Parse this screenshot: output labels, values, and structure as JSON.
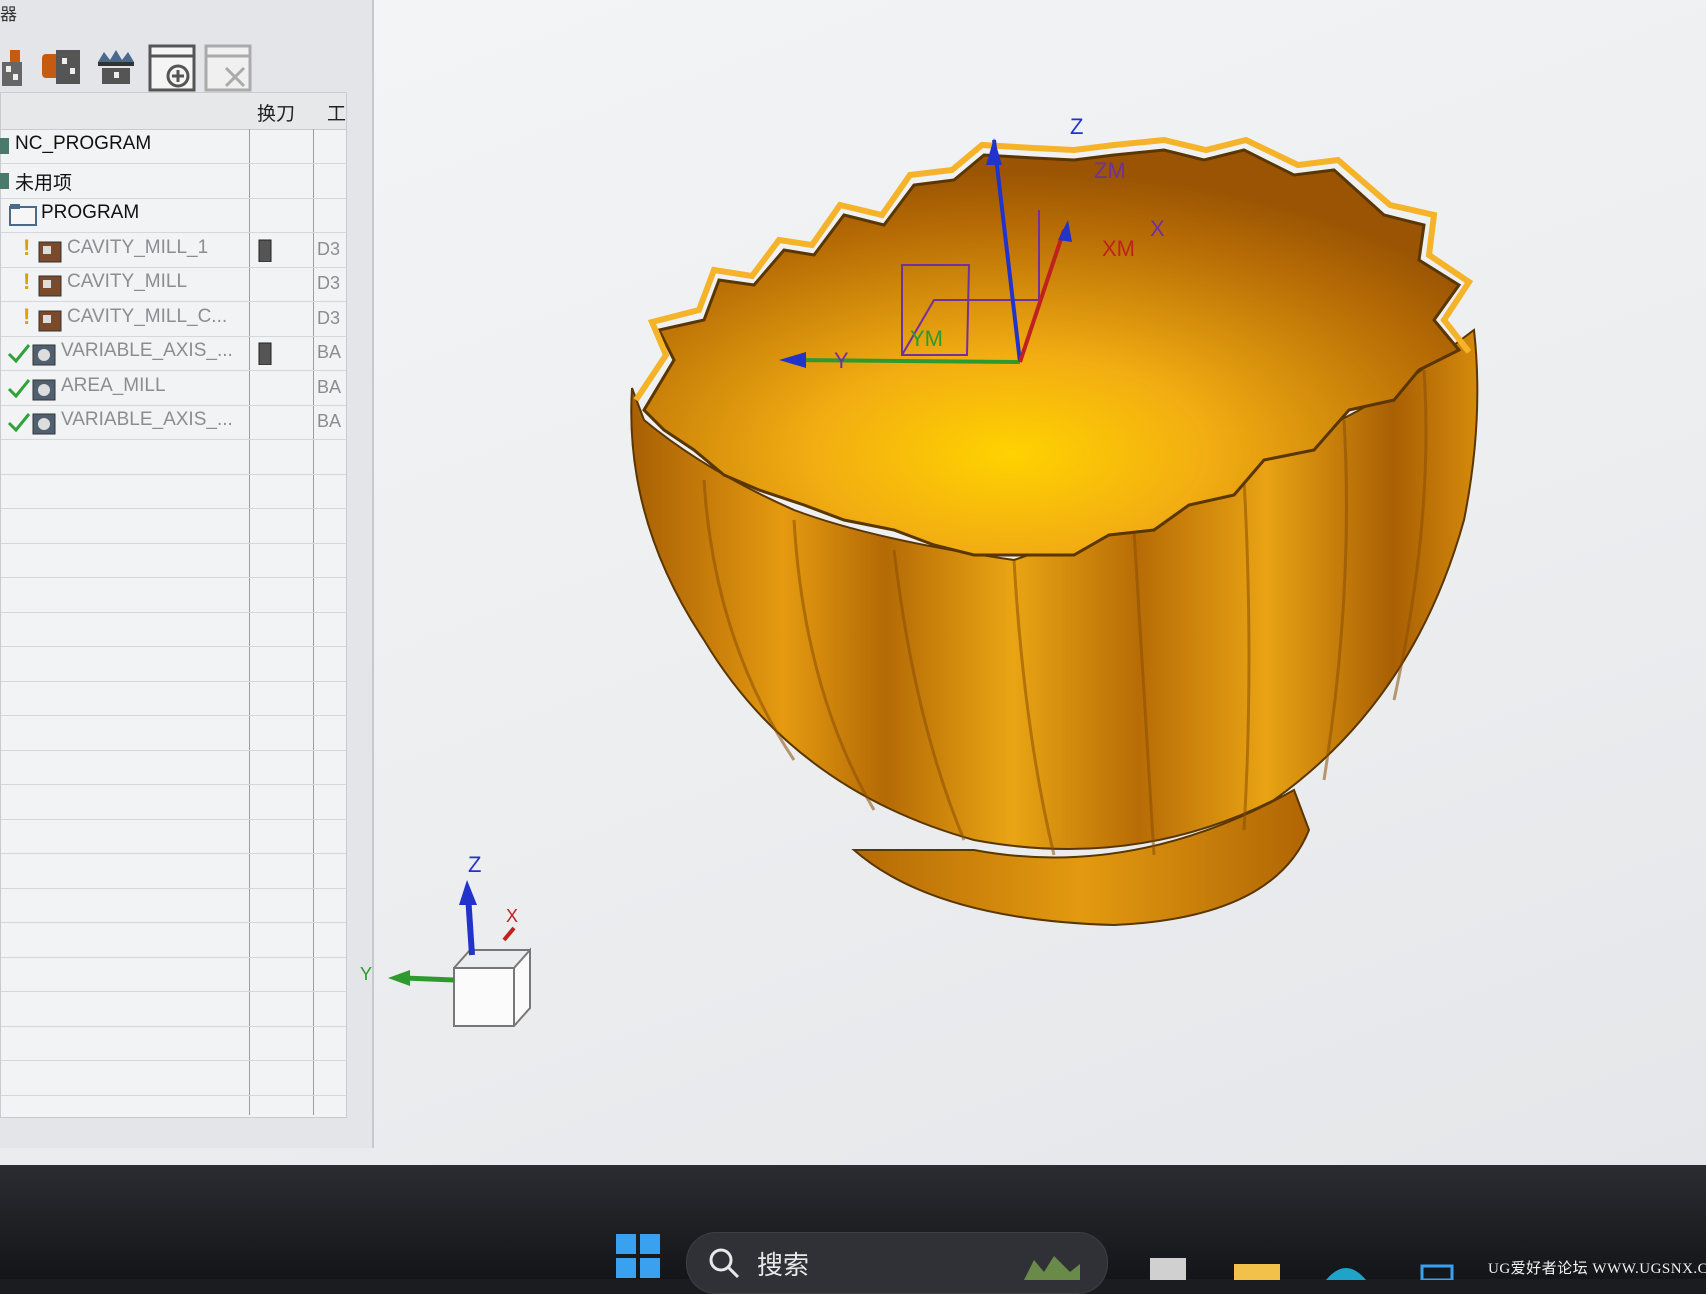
{
  "panel": {
    "title": "器",
    "columns": {
      "tool_change": "换刀",
      "work": "工"
    },
    "rows": [
      {
        "label": "NC_PROGRAM",
        "indent": 0,
        "status": "root",
        "col": ""
      },
      {
        "label": "未用项",
        "indent": 0,
        "status": "unused",
        "col": ""
      },
      {
        "label": "PROGRAM",
        "indent": 1,
        "status": "folder",
        "col": ""
      },
      {
        "label": "CAVITY_MILL_1",
        "indent": 2,
        "status": "warning",
        "col": "D3",
        "tool_change": true
      },
      {
        "label": "CAVITY_MILL",
        "indent": 2,
        "status": "warning",
        "col": "D3",
        "tool_change": false
      },
      {
        "label": "CAVITY_MILL_C...",
        "indent": 2,
        "status": "warning",
        "col": "D3",
        "tool_change": false
      },
      {
        "label": "VARIABLE_AXIS_...",
        "indent": 2,
        "status": "ok",
        "col": "BA",
        "tool_change": true
      },
      {
        "label": "AREA_MILL",
        "indent": 2,
        "status": "ok",
        "col": "BA",
        "tool_change": false
      },
      {
        "label": "VARIABLE_AXIS_...",
        "indent": 2,
        "status": "ok",
        "col": "BA",
        "tool_change": false
      }
    ]
  },
  "viewport": {
    "mcs_axes": {
      "z": "Z",
      "zm": "ZM",
      "x": "X",
      "xm": "XM",
      "y": "Y",
      "ym": "YM"
    },
    "triad": {
      "z": "Z",
      "x": "X",
      "y": "Y"
    },
    "model_color": "#d98a06"
  },
  "taskbar": {
    "search_text": "搜索",
    "watermark": "UG爱好者论坛 WWW.UGSNX.COM"
  }
}
